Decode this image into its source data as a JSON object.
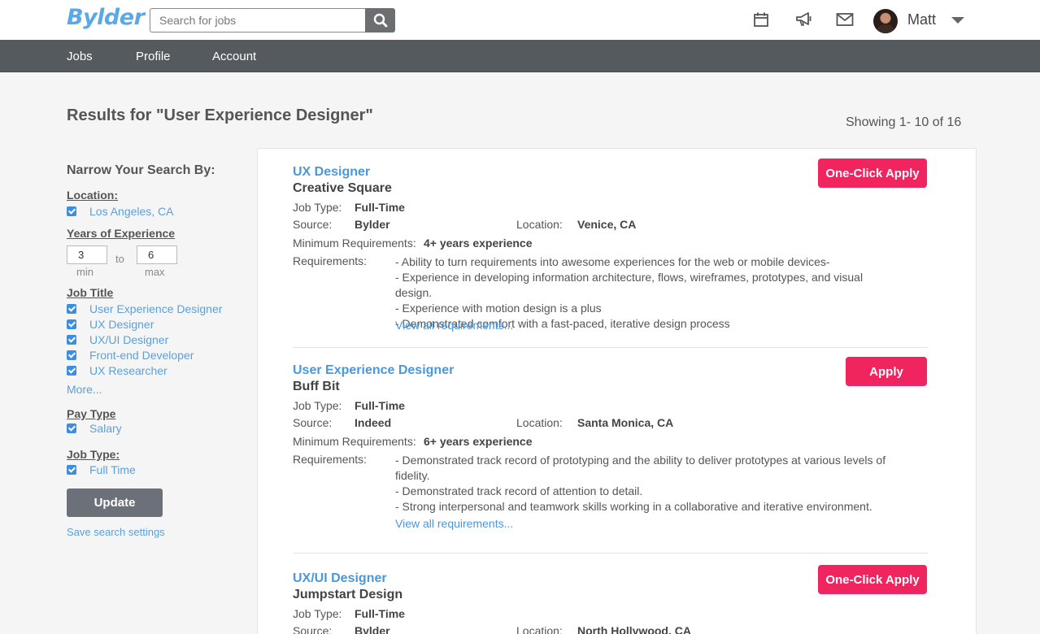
{
  "header": {
    "logo": "Bylder",
    "search_placeholder": "Search for jobs",
    "icons": [
      "calendar-icon",
      "megaphone-icon",
      "envelope-icon",
      "search-icon"
    ],
    "user_name": "Matt"
  },
  "nav": {
    "items": [
      "Jobs",
      "Profile",
      "Account"
    ]
  },
  "results": {
    "title": "Results for \"User Experience Designer\"",
    "showing": "Showing 1- 10 of 16"
  },
  "sidebar": {
    "title": "Narrow Your Search By:",
    "location_label": "Location:",
    "location_items": [
      "Los Angeles, CA"
    ],
    "experience_label": "Years of Experience",
    "exp_min": "3",
    "exp_max": "6",
    "exp_min_label": "min",
    "exp_to_label": "to",
    "exp_max_label": "max",
    "job_title_label": "Job Title",
    "job_title_items": [
      "User Experience Designer",
      "UX Designer",
      "UX/UI Designer",
      "Front-end Developer",
      "UX Researcher"
    ],
    "more_link": "More...",
    "pay_type_label": "Pay Type",
    "pay_type_items": [
      "Salary"
    ],
    "job_type_label": "Job Type:",
    "job_type_items": [
      "Full Time"
    ],
    "update_button": "Update",
    "save_link": "Save search settings"
  },
  "jobs": [
    {
      "title": "UX Designer",
      "company": "Creative Square",
      "job_type_key": "Job Type:",
      "job_type": "Full-Time",
      "source_key": "Source:",
      "source": "Bylder",
      "location_key": "Location:",
      "location": "Venice, CA",
      "min_req_key": "Minimum Requirements:",
      "min_req": "4+ years experience",
      "req_key": "Requirements:",
      "requirements": [
        "- Ability to turn requirements into awesome experiences for the web or mobile devices-",
        "- Experience in developing information architecture, flows, wireframes, prototypes, and visual design.",
        "- Experience with motion design is a plus",
        "- Demonstrated comfort with a fast-paced, iterative design process"
      ],
      "view_all": "View all requirements...",
      "apply_label": "One-Click Apply"
    },
    {
      "title": "User Experience Designer",
      "company": "Buff Bit",
      "job_type_key": "Job Type:",
      "job_type": "Full-Time",
      "source_key": "Source:",
      "source": "Indeed",
      "location_key": "Location:",
      "location": "Santa Monica, CA",
      "min_req_key": "Minimum Requirements:",
      "min_req": "6+ years experience",
      "req_key": "Requirements:",
      "requirements": [
        "- Demonstrated track record of prototyping and the ability to deliver prototypes at various levels of fidelity.",
        "- Demonstrated track record of attention to detail.",
        "- Strong interpersonal and teamwork skills working in a collaborative and iterative environment."
      ],
      "view_all": "View all requirements...",
      "apply_label": "Apply"
    },
    {
      "title": "UX/UI Designer",
      "company": "Jumpstart Design",
      "job_type_key": "Job Type:",
      "job_type": "Full-Time",
      "source_key": "Source:",
      "source": "Bylder",
      "location_key": "Location:",
      "location": "North Hollywood, CA",
      "apply_label": "One-Click Apply"
    }
  ],
  "colors": {
    "brand": "#5aa9e6",
    "nav_bg": "#555a5e",
    "apply": "#f0245e",
    "link": "#4a98d9"
  }
}
